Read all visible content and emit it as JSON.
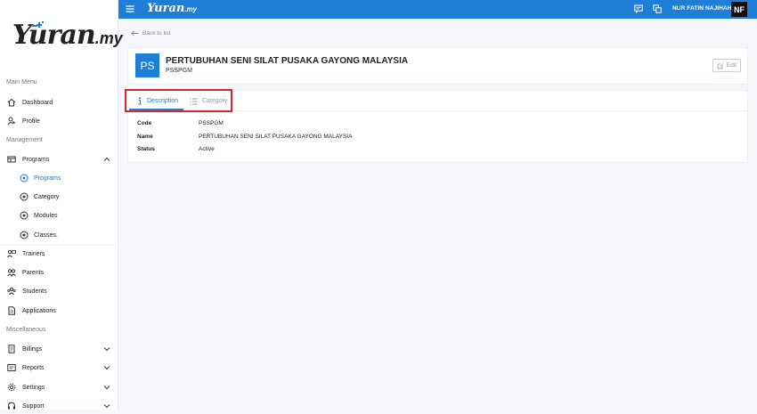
{
  "sidebar": {
    "logo": {
      "name": "Yuran",
      "suffix": ".my"
    },
    "sections": {
      "main_menu": "Main Menu",
      "management": "Management",
      "miscellaneous": "Miscellaneous"
    },
    "items": {
      "dashboard": "Dashboard",
      "profile": "Profile",
      "programs": "Programs",
      "programs_sub": "Programs",
      "category": "Category",
      "modules": "Modules",
      "classes": "Classes.",
      "trainers": "Trainers",
      "parents": "Parents",
      "students": "Students",
      "applications": "Applications",
      "billings": "Billings",
      "reports": "Reports",
      "settings": "Settings",
      "support": "Support"
    }
  },
  "topbar": {
    "brand": "Yuran",
    "brand_suffix": ".my",
    "user_name": "NUR FATIN NAJIHAH",
    "avatar_initials": "NF",
    "color": "#1e7fd6"
  },
  "page": {
    "back_label": "Back to list",
    "org_initials": "PS",
    "org_name": "PERTUBUHAN SENI SILAT PUSAKA GAYONG MALAYSIA",
    "org_code": "PSSPGM",
    "edit_label": "Edit",
    "tabs": {
      "description": "Description",
      "category": "Category"
    },
    "details": {
      "code_label": "Code",
      "code_value": "PSSPGM",
      "name_label": "Name",
      "name_value": "PERTUBUHAN SENI SILAT PUSAKA GAYONG MALAYSIA",
      "status_label": "Status",
      "status_value": "Active"
    }
  }
}
